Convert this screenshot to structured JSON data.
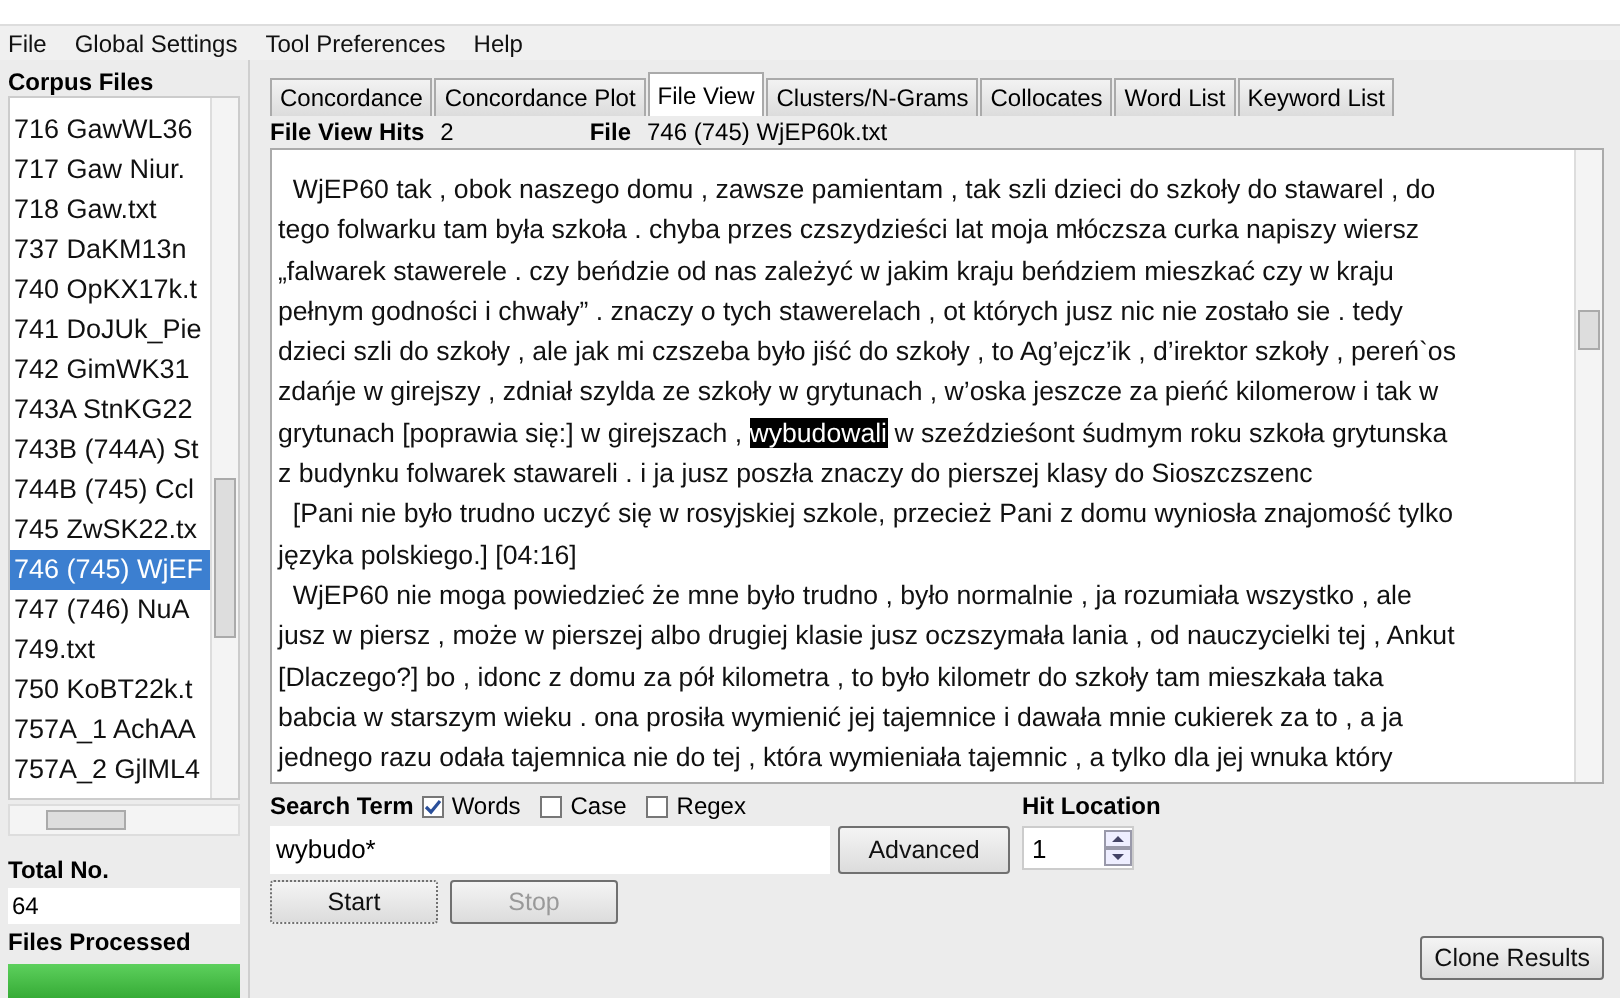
{
  "menu": [
    "File",
    "Global Settings",
    "Tool Preferences",
    "Help"
  ],
  "corpus": {
    "title": "Corpus Files",
    "files": [
      {
        "name": "716 GawWL36",
        "selected": false
      },
      {
        "name": "717 Gaw Niur.",
        "selected": false
      },
      {
        "name": "718 Gaw.txt",
        "selected": false
      },
      {
        "name": "737 DaKM13n",
        "selected": false
      },
      {
        "name": "740 OpKX17k.t",
        "selected": false
      },
      {
        "name": "741 DoJUk_Pie",
        "selected": false
      },
      {
        "name": "742 GimWK31",
        "selected": false
      },
      {
        "name": "743A StnKG22",
        "selected": false
      },
      {
        "name": "743B (744A) St",
        "selected": false
      },
      {
        "name": "744B (745) Ccl",
        "selected": false
      },
      {
        "name": "745 ZwSK22.tx",
        "selected": false
      },
      {
        "name": "746 (745) WjEF",
        "selected": true
      },
      {
        "name": "747 (746) NuA",
        "selected": false
      },
      {
        "name": "749.txt",
        "selected": false
      },
      {
        "name": "750 KoBT22k.t",
        "selected": false
      },
      {
        "name": "757A_1 AchAA",
        "selected": false
      },
      {
        "name": "757A_2 GjlML4",
        "selected": false
      }
    ],
    "total_label": "Total No.",
    "total": "64",
    "processed_label": "Files Processed",
    "progress": {
      "level": 1
    }
  },
  "tabs": [
    {
      "label": "Concordance",
      "selected": false
    },
    {
      "label": "Concordance Plot",
      "selected": false
    },
    {
      "label": "File View",
      "selected": true
    },
    {
      "label": "Clusters/N-Grams",
      "selected": false
    },
    {
      "label": "Collocates",
      "selected": false
    },
    {
      "label": "Word List",
      "selected": false
    },
    {
      "label": "Keyword List",
      "selected": false
    }
  ],
  "file_view": {
    "hits_label": "File View Hits",
    "hits": "2",
    "file_label": "File",
    "file": "746 (745) WjEP60k.txt",
    "lines": [
      [
        {
          "text": "  WjEP60 tak , obok naszego domu , zawsze pamientam , tak szli dzieci do szkoły do stawarel , do",
          "hit": false
        }
      ],
      [
        {
          "text": "tego folwarku tam była szkoła . chyba przes czszydzieści lat moja młóczsza curka napiszy wiersz",
          "hit": false
        }
      ],
      [
        {
          "text": "„falwarek stawerele . czy beńdzie od nas zależyć w jakim kraju beńdziem mieszkać czy w kraju",
          "hit": false
        }
      ],
      [
        {
          "text": "pełnym godności i chwały” . znaczy o tych stawerelach , ot których jusz nic nie zostało sie . tedy",
          "hit": false
        }
      ],
      [
        {
          "text": "dzieci szli do szkoły , ale jak mi czszeba było jiść do szkoły , to Ag’ejcz’ik , d’irektor szkoły , pereń`os",
          "hit": false
        }
      ],
      [
        {
          "text": "zdańje w girejszy , zdniał szylda ze szkoły w grytunach , w’oska jeszcze za pieńć kilomerow i tak w",
          "hit": false
        }
      ],
      [
        {
          "text": "grytunach [poprawia się:] w girejszach , ",
          "hit": false
        },
        {
          "text": "wybudowali",
          "hit": true
        },
        {
          "text": " w szeździeśont śudmym roku szkoła grytunska",
          "hit": false
        }
      ],
      [
        {
          "text": "z budynku folwarek stawareli . i ja jusz poszła znaczy do pierszej klasy do Sioszczszenc",
          "hit": false
        }
      ],
      [
        {
          "text": "  [Pani nie było trudno uczyć się w rosyjskiej szkole, przecież Pani z domu wyniosła znajomość tylko",
          "hit": false
        }
      ],
      [
        {
          "text": "języka polskiego.] [04:16]",
          "hit": false
        }
      ],
      [
        {
          "text": "  WjEP60 nie moga powiedzieć że mne było trudno , było normalnie , ja rozumiała wszystko , ale",
          "hit": false
        }
      ],
      [
        {
          "text": "jusz w piersz , może w pierszej albo drugiej klasie jusz oczszymała lania , od nauczycielki tej , Ankut",
          "hit": false
        }
      ],
      [
        {
          "text": "[Dlaczego?] bo , idonc z domu za pół kilometra , to było kilometr do szkoły tam mieszkała taka",
          "hit": false
        }
      ],
      [
        {
          "text": "babcia w starszym wieku . ona prosiła wymienić jej tajemnice i dawała mnie cukierek za to , a ja",
          "hit": false
        }
      ],
      [
        {
          "text": "jednego razu odała tajemnica nie do tej , która wymieniała tajemnic , a tylko dla jej wnuka który",
          "hit": false
        }
      ]
    ]
  },
  "search": {
    "label": "Search Term",
    "options": [
      {
        "label": "Words",
        "checked": true
      },
      {
        "label": "Case",
        "checked": false
      },
      {
        "label": "Regex",
        "checked": false
      }
    ],
    "value": "wybudo*",
    "advanced": "Advanced",
    "start": "Start",
    "stop": "Stop",
    "stop_disabled": true,
    "hit_location_label": "Hit Location",
    "hit_location": "1"
  },
  "clone": "Clone Results"
}
